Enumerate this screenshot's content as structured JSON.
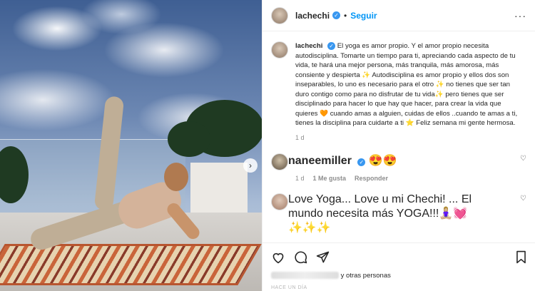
{
  "post": {
    "username": "lachechi",
    "follow_label": "Seguir",
    "dot": "•",
    "more_label": "···",
    "verified_glyph": "✓"
  },
  "caption": {
    "username": "lachechi",
    "text": "El yoga es amor propio. Y el amor propio necesita autodisciplina. Tomarte un tiempo para ti, apreciando cada aspecto de tu vida, te hará una mejor persona, más tranquila, más amorosa, más consiente y despierta ✨ Autodisciplina es amor propio y ellos dos son inseparables, lo uno es necesario para el otro ✨ no tienes que ser tan duro contigo como para no disfrutar de tu vida✨ pero tienes que ser disciplinado para hacer lo que hay que hacer, para crear la vida que quieres 🧡 cuando amas a alguien, cuidas de ellos ..cuando te amas a ti, tienes la disciplina para cuidarte a ti ⭐ Feliz semana mi gente hermosa.",
    "age": "1 d"
  },
  "comments": [
    {
      "username": "naneemiller",
      "text": "😍😍",
      "age": "1 d",
      "likes": "1 Me gusta",
      "reply_label": "Responder"
    },
    {
      "username": "",
      "text": "Love Yoga... Love u mi Chechi! ... El mundo necesita más YOGA!!!🧘🏼‍♀️💓✨✨✨"
    }
  ],
  "likes_text": "y otras personas",
  "posted_label": "HACE UN DÍA",
  "icons": {
    "like": "heart-icon",
    "comment": "comment-icon",
    "share": "share-icon",
    "save": "bookmark-icon",
    "next": "chevron-right-icon"
  }
}
